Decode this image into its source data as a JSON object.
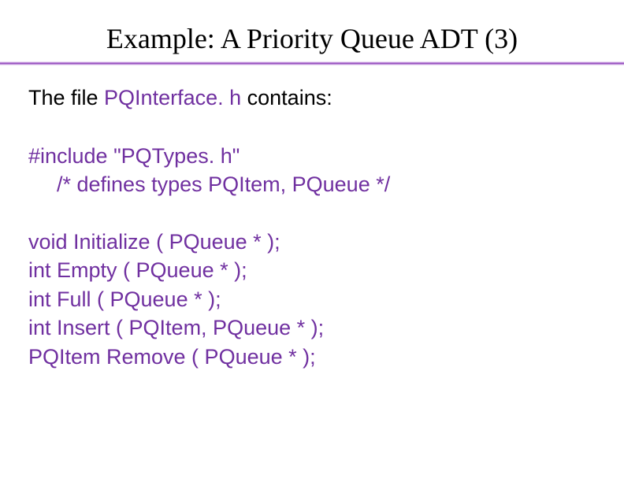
{
  "title": "Example: A Priority Queue ADT (3)",
  "intro": {
    "prefix": "The file ",
    "filename": "PQInterface. h",
    "suffix": " contains:"
  },
  "code": {
    "include": "#include \"PQTypes. h\"",
    "comment": "/* defines types PQItem, PQueue */",
    "fn_initialize": "void Initialize ( PQueue * );",
    "fn_empty": "int Empty ( PQueue * );",
    "fn_full": "int Full ( PQueue * );",
    "fn_insert": "int Insert ( PQItem, PQueue * );",
    "fn_remove": "PQItem Remove ( PQueue * );"
  }
}
